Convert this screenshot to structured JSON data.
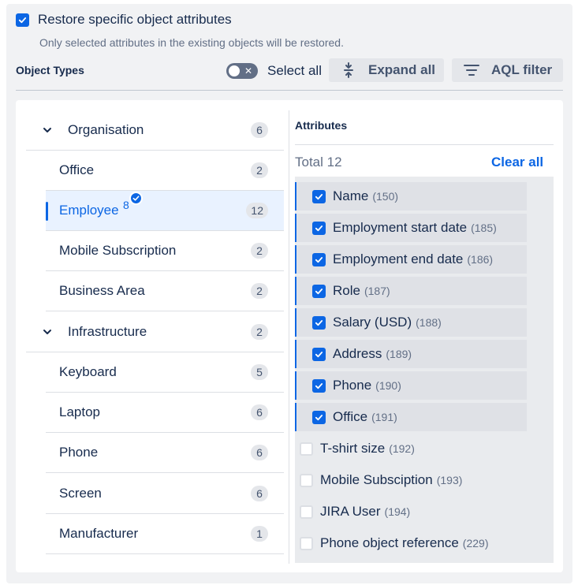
{
  "header": {
    "restore_label": "Restore specific object attributes",
    "restore_checked": true,
    "restore_description": "Only selected attributes in the existing objects will be restored."
  },
  "toolbar": {
    "object_types_label": "Object Types",
    "select_all_label": "Select all",
    "select_all_on": false,
    "expand_all_label": "Expand all",
    "aql_filter_label": "AQL filter"
  },
  "tree": [
    {
      "label": "Organisation",
      "count": "6",
      "type": "parent",
      "expanded": true
    },
    {
      "label": "Office",
      "count": "2",
      "type": "child"
    },
    {
      "label": "Employee",
      "count": "12",
      "type": "child",
      "selected": true,
      "selected_count": "8"
    },
    {
      "label": "Mobile Subscription",
      "count": "2",
      "type": "child"
    },
    {
      "label": "Business Area",
      "count": "2",
      "type": "child"
    },
    {
      "label": "Infrastructure",
      "count": "2",
      "type": "parent",
      "expanded": true
    },
    {
      "label": "Keyboard",
      "count": "5",
      "type": "child"
    },
    {
      "label": "Laptop",
      "count": "6",
      "type": "child"
    },
    {
      "label": "Phone",
      "count": "6",
      "type": "child"
    },
    {
      "label": "Screen",
      "count": "6",
      "type": "child"
    },
    {
      "label": "Manufacturer",
      "count": "1",
      "type": "child"
    }
  ],
  "attributes": {
    "title": "Attributes",
    "total_label": "Total 12",
    "clear_all_label": "Clear all",
    "items": [
      {
        "name": "Name",
        "id": "(150)",
        "checked": true
      },
      {
        "name": "Employment start date",
        "id": "(185)",
        "checked": true
      },
      {
        "name": "Employment end date",
        "id": "(186)",
        "checked": true
      },
      {
        "name": "Role",
        "id": "(187)",
        "checked": true
      },
      {
        "name": "Salary (USD)",
        "id": "(188)",
        "checked": true
      },
      {
        "name": "Address",
        "id": "(189)",
        "checked": true
      },
      {
        "name": "Phone",
        "id": "(190)",
        "checked": true
      },
      {
        "name": "Office",
        "id": "(191)",
        "checked": true
      },
      {
        "name": "T-shirt size",
        "id": "(192)",
        "checked": false
      },
      {
        "name": "Mobile Subsciption",
        "id": "(193)",
        "checked": false
      },
      {
        "name": "JIRA User",
        "id": "(194)",
        "checked": false
      },
      {
        "name": "Phone object reference",
        "id": "(229)",
        "checked": false
      }
    ]
  },
  "icons": {
    "checkbox": "checkbox-icon",
    "toggle_off": "close-icon",
    "expand": "expand-vertical-icon",
    "filter": "filter-icon",
    "chevron": "chevron-down-icon",
    "selected_badge": "check-circle-icon"
  },
  "colors": {
    "accent": "#0c66e4",
    "text": "#172b4d",
    "subtle_text": "#626f86",
    "selected_bg": "#e9f2ff"
  }
}
